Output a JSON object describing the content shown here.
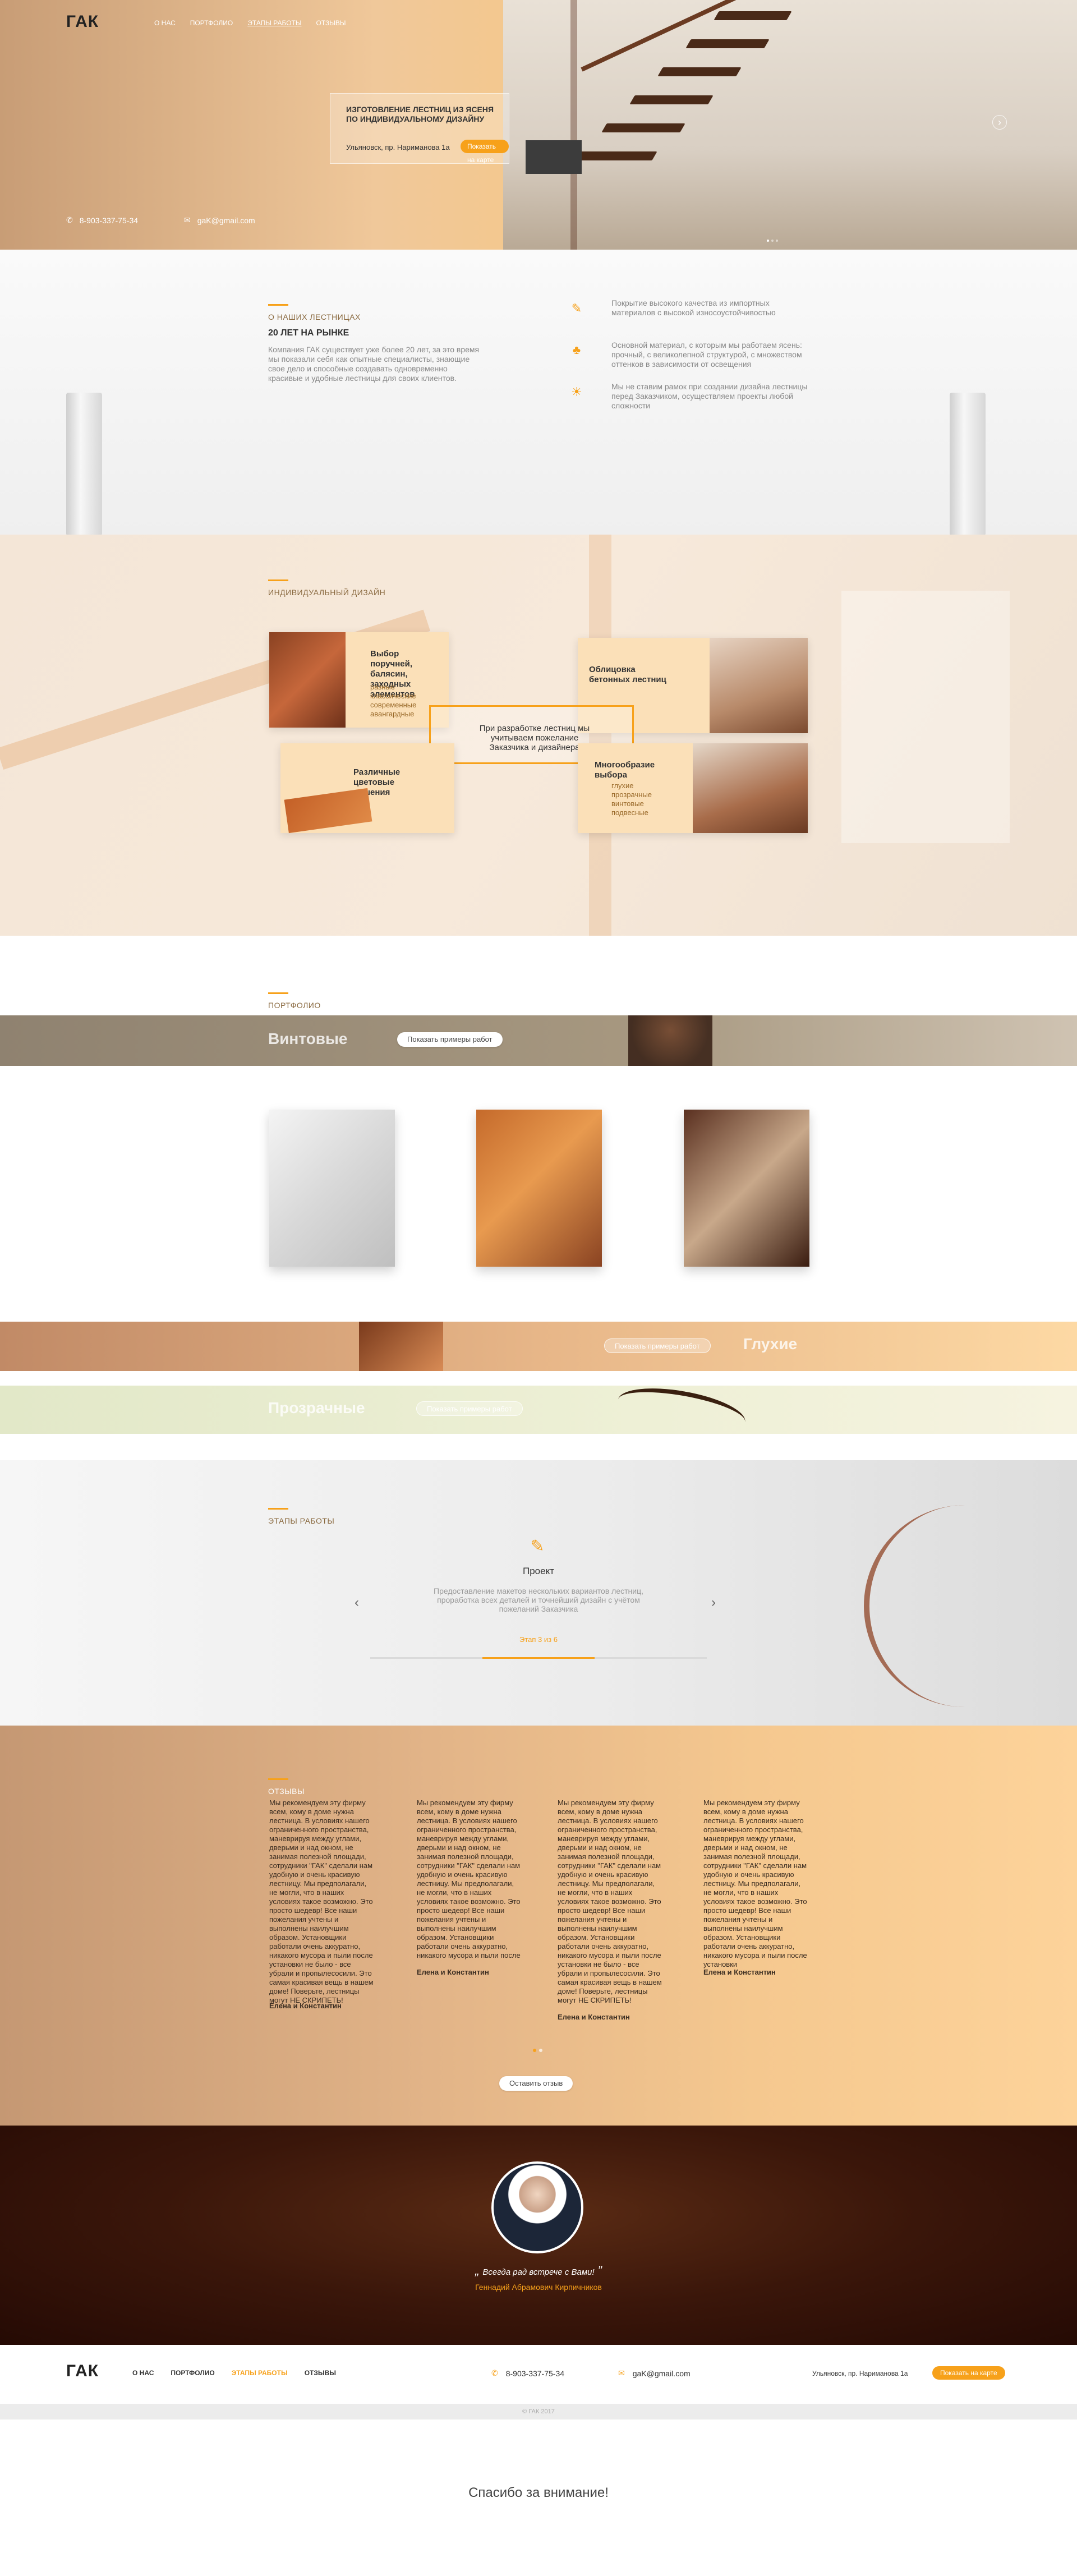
{
  "brand": {
    "logo": "ГАК",
    "accent": "#f7a11a"
  },
  "nav": {
    "items": [
      "О нас",
      "Портфолио",
      "Этапы работы",
      "Отзывы"
    ]
  },
  "hero": {
    "title_line1": "ИЗГОТОВЛЕНИЕ ЛЕСТНИЦ ИЗ ЯСЕНЯ",
    "title_line2": "ПО ИНДИВИДУАЛЬНОМУ ДИЗАЙНУ",
    "address": "Ульяновск, пр. Нариманова 1а",
    "map_button": "Показать на карте",
    "phone": "8-903-337-75-34",
    "email": "gaK@gmail.com"
  },
  "about": {
    "label": "О НАШИХ ЛЕСТНИЦАХ",
    "title": "20 ЛЕТ НА РЫНКЕ",
    "text": "Компания ГАК существует уже более 20 лет, за это время мы показали себя как опытные специалисты, знающие свое дело и способные создавать одновременно красивые и удобные лестницы для своих клиентов.",
    "features": [
      "Покрытие высокого качества из импортных материалов с высокой износоустойчивостью",
      "Основной материал, с которым мы работаем ясень: прочный, с великолепной структурой, с множеством оттенков в зависимости от освещения",
      "Мы не ставим рамок при создании дизайна лестницы перед Заказчиком, осуществляем проекты любой сложности"
    ]
  },
  "design": {
    "label": "ИНДИВИДУАЛЬНЫЙ ДИЗАЙН",
    "card1_title": "Выбор поручней, балясин, заходных элементов",
    "card1_sub": "разные классические современные авангардные",
    "card2_title": "Облицовка бетонных лестниц",
    "card3_title": "Различные цветовые решения",
    "card4_title": "Многообразие выбора",
    "card4_sub": "глухие прозрачные винтовые подвесные",
    "center_text": "При разработке лестниц мы учитываем пожелание Заказчика и дизайнера"
  },
  "portfolio": {
    "label": "ПОРТФОЛИО",
    "bands": [
      {
        "title": "Винтовые",
        "button": "Показать примеры работ"
      },
      {
        "title": "Глухие",
        "button": "Показать примеры работ"
      },
      {
        "title": "Прозрачные",
        "button": "Показать примеры работ"
      }
    ]
  },
  "steps": {
    "label": "ЭТАПЫ РАБОТЫ",
    "step_title": "Проект",
    "step_text": "Предоставление макетов нескольких вариантов лестниц, проработка всех деталей и точнейший дизайн с учётом пожеланий Заказчика",
    "step_counter": "Этап 3 из 6",
    "progress": 0.5,
    "prev_icon": "chevron-left-icon",
    "next_icon": "chevron-right-icon"
  },
  "reviews": {
    "label": "ОТЗЫВЫ",
    "items": [
      {
        "text": "Мы рекомендуем эту фирму всем, кому в доме нужна лестница. В условиях нашего ограниченного пространства, маневрируя между углами, дверьми и над окном, не занимая полезной площади, сотрудники \"ГАК\" сделали нам удобную и очень красивую лестницу. Мы предполагали, не могли, что в наших условиях такое возможно. Это просто шедевр! Все наши пожелания учтены и выполнены наилучшим образом. Установщики работали очень аккуратно, никакого мусора и пыли после установки не было - все убрали и пропылесосили. Это самая красивая вещь в нашем доме! Поверьте, лестницы могут НЕ СКРИПЕТЬ!",
        "author": "Елена и Константин"
      },
      {
        "text": "Мы рекомендуем эту фирму всем, кому в доме нужна лестница. В условиях нашего ограниченного пространства, маневрируя между углами, дверьми и над окном, не занимая полезной площади, сотрудники \"ГАК\" сделали нам удобную и очень красивую лестницу. Мы предполагали, не могли, что в наших условиях такое возможно. Это просто шедевр! Все наши пожелания учтены и выполнены наилучшим образом. Установщики работали очень аккуратно, никакого мусора и пыли после",
        "author": "Елена и Константин"
      },
      {
        "text": "Мы рекомендуем эту фирму всем, кому в доме нужна лестница. В условиях нашего ограниченного пространства, маневрируя между углами, дверьми и над окном, не занимая полезной площади, сотрудники \"ГАК\" сделали нам удобную и очень красивую лестницу. Мы предполагали, не могли, что в наших условиях такое возможно. Это просто шедевр! Все наши пожелания учтены и выполнены наилучшим образом. Установщики работали очень аккуратно, никакого мусора и пыли после установки не было - все убрали и пропылесосили. Это самая красивая вещь в нашем доме! Поверьте, лестницы могут НЕ СКРИПЕТЬ!",
        "author": "Елена и Константин"
      },
      {
        "text": "Мы рекомендуем эту фирму всем, кому в доме нужна лестница. В условиях нашего ограниченного пространства, маневрируя между углами, дверьми и над окном, не занимая полезной площади, сотрудники \"ГАК\" сделали нам удобную и очень красивую лестницу. Мы предполагали, не могли, что в наших условиях такое возможно. Это просто шедевр! Все наши пожелания учтены и выполнены наилучшим образом. Установщики работали очень аккуратно, никакого мусора и пыли после установки",
        "author": "Елена и Константин"
      }
    ],
    "button": "Оставить отзыв"
  },
  "founder": {
    "quote": "Всегда рад встрече с Вами!",
    "name": "Геннадий Абрамович Кирпичников"
  },
  "footer": {
    "logo": "ГАК",
    "nav": [
      "О нас",
      "Портфолио",
      "Этапы работы",
      "Отзывы"
    ],
    "phone": "8-903-337-75-34",
    "email": "gaK@gmail.com",
    "address": "Ульяновск, пр. Нариманова 1а",
    "map_button": "Показать на карте",
    "copyright": "© ГАК 2017"
  },
  "thanks": "Спасибо за внимание!"
}
